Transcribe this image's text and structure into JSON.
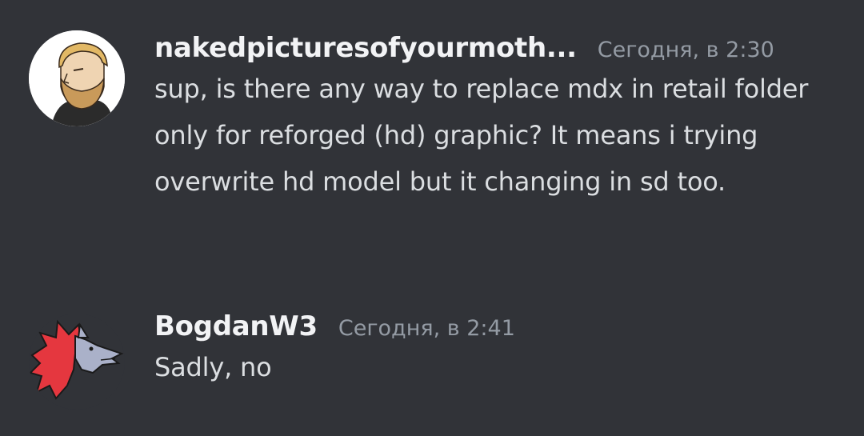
{
  "messages": [
    {
      "username": "nakedpicturesofyourmoth...",
      "timestamp": "Сегодня, в 2:30",
      "text": "sup, is there any way to replace mdx in retail folder only for reforged (hd) graphic? It means i trying overwrite hd model but it changing in sd too.",
      "avatar_icon": "bearded-man-avatar-icon"
    },
    {
      "username": "BogdanW3",
      "timestamp": "Сегодня, в 2:41",
      "text": "Sadly, no",
      "avatar_icon": "red-wolf-avatar-icon"
    }
  ],
  "colors": {
    "background": "#313338",
    "username": "#f2f3f5",
    "timestamp": "#949ba4",
    "text": "#dbdee1"
  }
}
